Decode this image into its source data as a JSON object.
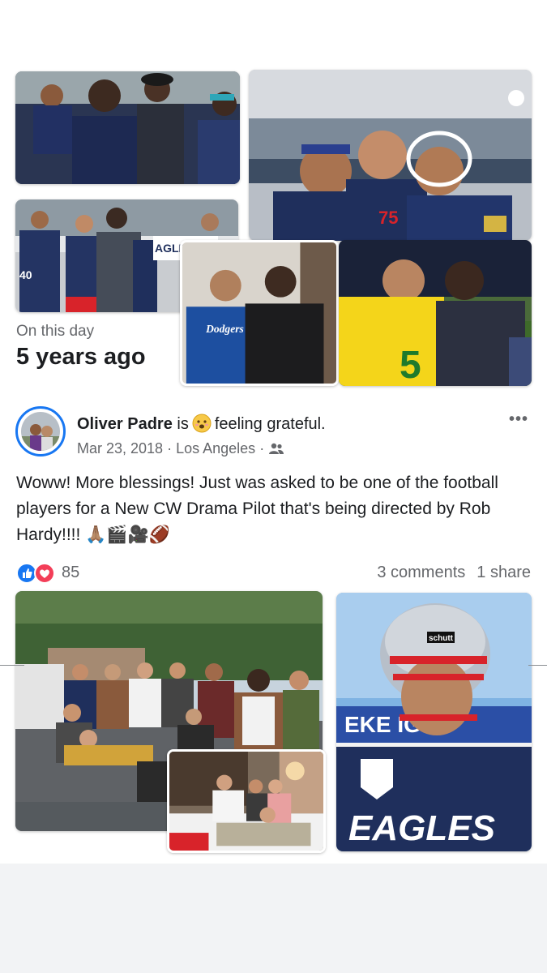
{
  "memory": {
    "label": "On this day",
    "title": "5 years ago"
  },
  "post": {
    "author": "Oliver Padre",
    "is_text": "is",
    "feeling": "feeling grateful.",
    "date": "Mar 23, 2018",
    "location": "Los Angeles",
    "separator": "·",
    "audience_icon": "friends-icon",
    "more_icon": "more-options-icon",
    "more_label": "•••",
    "text": "Woww! More blessings! Just was asked to be one of the football players for a New CW Drama Pilot that's being directed by Rob Hardy!!!! 🙏🏽🎬🎥🏈"
  },
  "engagement": {
    "reaction_count": "85",
    "comments": "3 comments",
    "shares": "1 share",
    "reaction_icons": [
      "like-icon",
      "love-icon"
    ]
  },
  "colors": {
    "accent": "#1877f2",
    "love": "#f33e58",
    "text": "#1c1e21",
    "secondary": "#65676b",
    "jersey_navy": "#1f2f5c",
    "helmet_red": "#d8232a"
  }
}
